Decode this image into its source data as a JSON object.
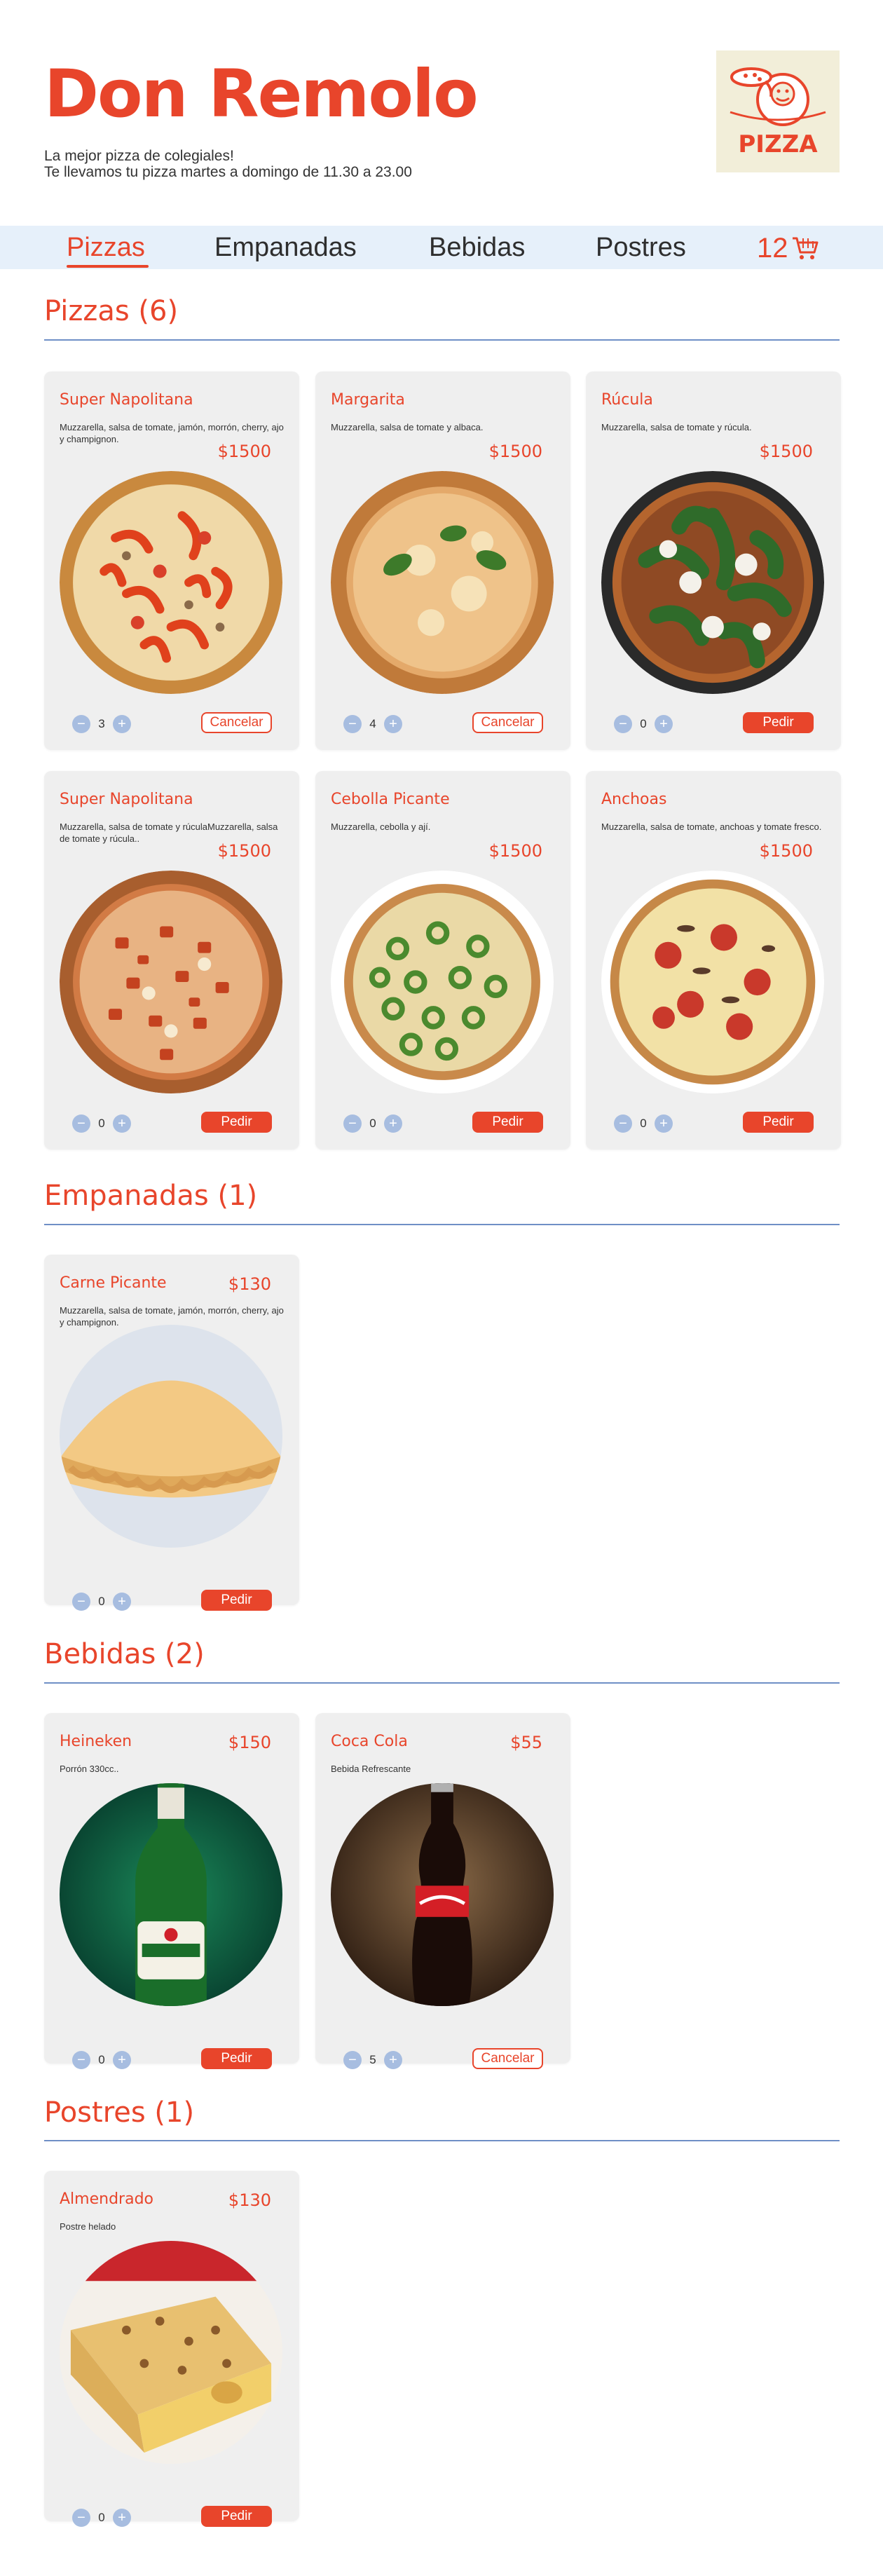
{
  "header": {
    "title": "Don Remolo",
    "tagline_1": "La mejor pizza de colegiales!",
    "tagline_2": "Te llevamos tu pizza martes a domingo de 11.30 a 23.00",
    "logo_text": "PIZZA"
  },
  "nav": {
    "items": [
      "Pizzas",
      "Empanadas",
      "Bebidas",
      "Postres"
    ],
    "active": "Pizzas",
    "cart_count": "12"
  },
  "colors": {
    "accent": "#e8452b",
    "nav_bg": "#e6f0fa",
    "card_bg": "#efefef",
    "stepper": "#a7bde0",
    "divider": "#6f8fc6"
  },
  "sections": {
    "pizzas": {
      "title": "Pizzas (6)",
      "items": [
        {
          "name": "Super Napolitana",
          "desc": "Muzzarella, salsa de tomate, jamón, morrón, cherry, ajo y champignon.",
          "price": "$1500",
          "qty": "3",
          "action": "Cancelar"
        },
        {
          "name": "Margarita",
          "desc": "Muzzarella, salsa de tomate y albaca.",
          "price": "$1500",
          "qty": "4",
          "action": "Cancelar"
        },
        {
          "name": "Rúcula",
          "desc": "Muzzarella, salsa de tomate y rúcula.",
          "price": "$1500",
          "qty": "0",
          "action": "Pedir"
        },
        {
          "name": "Super Napolitana",
          "desc": "Muzzarella, salsa de tomate y rúculaMuzzarella, salsa de tomate y rúcula..",
          "price": "$1500",
          "qty": "0",
          "action": "Pedir"
        },
        {
          "name": "Cebolla Picante",
          "desc": "Muzzarella, cebolla y ají.",
          "price": "$1500",
          "qty": "0",
          "action": "Pedir"
        },
        {
          "name": "Anchoas",
          "desc": "Muzzarella, salsa de tomate, anchoas y tomate fresco.",
          "price": "$1500",
          "qty": "0",
          "action": "Pedir"
        }
      ]
    },
    "empanadas": {
      "title": "Empanadas (1)",
      "items": [
        {
          "name": "Carne Picante",
          "desc": "Muzzarella, salsa de tomate, jamón, morrón, cherry, ajo y champignon.",
          "price": "$130",
          "qty": "0",
          "action": "Pedir"
        }
      ]
    },
    "bebidas": {
      "title": "Bebidas (2)",
      "items": [
        {
          "name": "Heineken",
          "desc": "Porrón 330cc..",
          "price": "$150",
          "qty": "0",
          "action": "Pedir"
        },
        {
          "name": "Coca Cola",
          "desc": "Bebida Refrescante",
          "price": "$55",
          "qty": "5",
          "action": "Cancelar"
        }
      ]
    },
    "postres": {
      "title": "Postres (1)",
      "items": [
        {
          "name": "Almendrado",
          "desc": "Postre helado",
          "price": "$130",
          "qty": "0",
          "action": "Pedir"
        }
      ]
    }
  },
  "stepper": {
    "minus": "−",
    "plus": "+"
  },
  "images": {
    "pizza_1": "pizza-napolitana-photo",
    "pizza_2": "pizza-margarita-photo",
    "pizza_3": "pizza-rucula-photo",
    "pizza_4": "pizza-napolitana-2-photo",
    "pizza_5": "pizza-cebolla-picante-photo",
    "pizza_6": "pizza-anchoas-photo",
    "empanada": "empanada-photo",
    "heineken": "heineken-bottle-photo",
    "cocacola": "coca-cola-bottle-photo",
    "almendrado": "almendrado-dessert-photo"
  }
}
